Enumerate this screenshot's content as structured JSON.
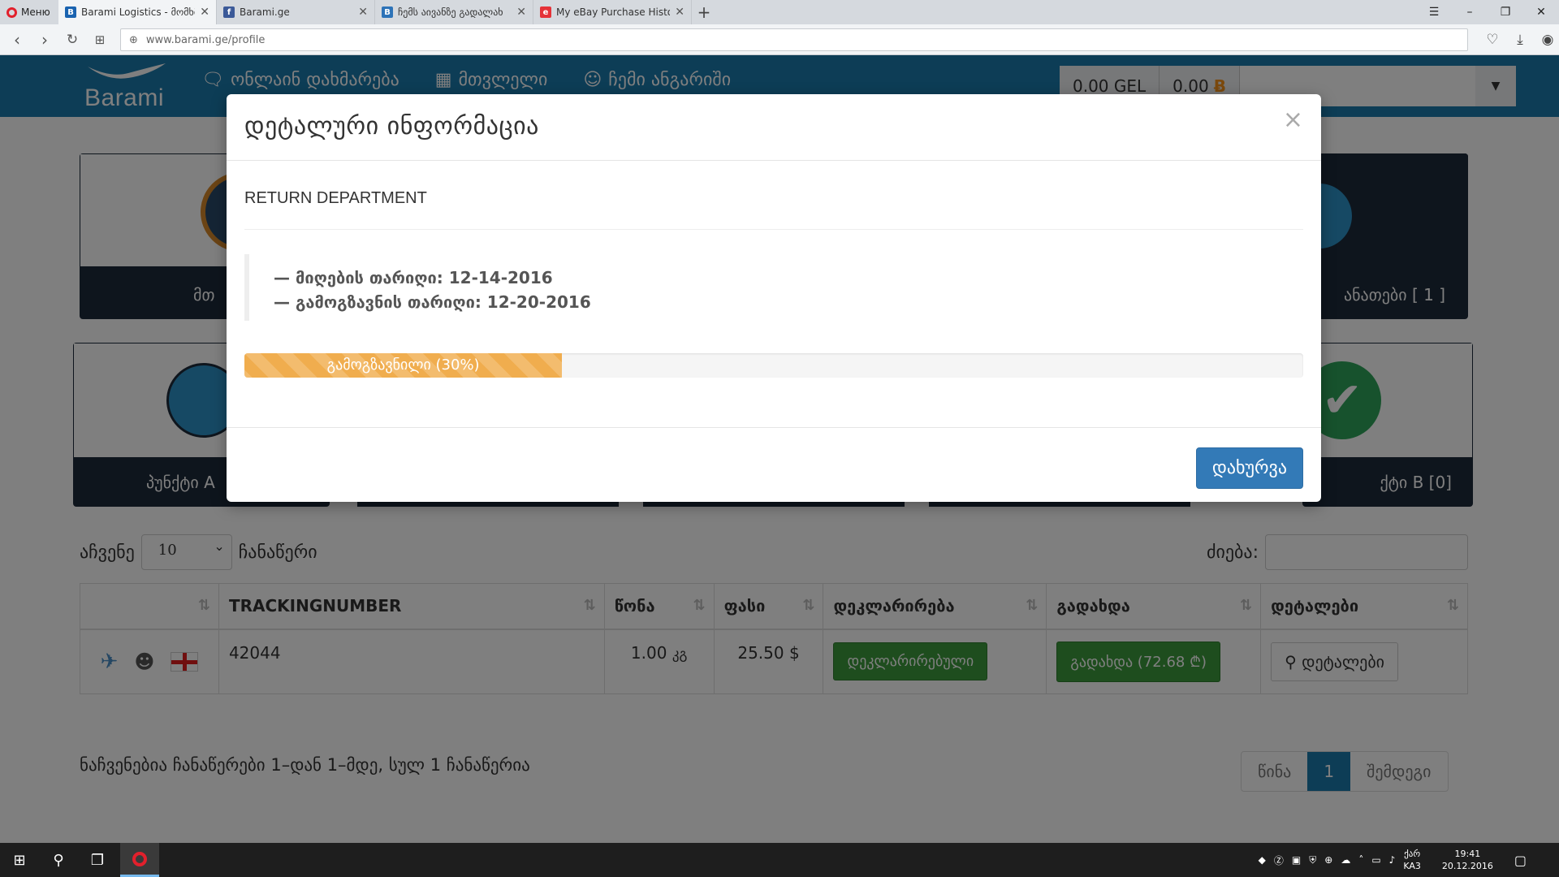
{
  "browser": {
    "menu_label": "Меню",
    "tabs": [
      {
        "title": "Barami Logistics - მომხმ",
        "fav": "B",
        "color": "#1a63b0"
      },
      {
        "title": "Barami.ge",
        "fav": "f",
        "color": "#3b5998"
      },
      {
        "title": "ჩემს აივანზე გადალახ",
        "fav": "B",
        "color": "#2d73b8"
      },
      {
        "title": "My eBay Purchase History",
        "fav": "e",
        "color": "#e53238"
      }
    ],
    "new_tab": "+",
    "url": "www.barami.ge/profile"
  },
  "site": {
    "logo": "Barami",
    "nav": [
      {
        "icon": "chat",
        "label": "ონლაინ დახმარება"
      },
      {
        "icon": "calculator",
        "label": "მთვლელი"
      },
      {
        "icon": "user",
        "label": "ჩემი ანგარიში"
      }
    ],
    "balance_gel": "0.00 GEL",
    "balance_btc": "0.00",
    "btc_symbol": "Ƀ"
  },
  "cards": [
    {
      "label": "მთ"
    },
    {
      "label": "ანათები [ 1 ]"
    },
    {
      "label": "პუნქტი A"
    },
    {
      "label": "ქტი B [0]"
    }
  ],
  "table_controls": {
    "show_label": "აჩვენე",
    "length_value": "10",
    "records_label": "ჩანაწერი",
    "search_label": "ძიება:"
  },
  "table": {
    "headers": [
      "",
      "TRACKINGNUMBER",
      "წონა",
      "ფასი",
      "დეკლარირება",
      "გადახდა",
      "დეტალები"
    ],
    "row": {
      "tracking": "42044",
      "weight": "1.00",
      "weight_unit": "კგ",
      "price": "25.50 $",
      "declare_btn": "დეკლარირებული",
      "pay_btn": "გადახდა (72.68 ₾)",
      "details_btn": "დეტალები"
    }
  },
  "info_text": "ნაჩვენებია ჩანაწერები 1–დან 1–მდე, სულ 1 ჩანაწერია",
  "pager": {
    "prev": "წინა",
    "current": "1",
    "next": "შემდეგი"
  },
  "modal": {
    "title": "დეტალური ინფორმაცია",
    "close_x": "×",
    "department": "RETURN DEPARTMENT",
    "received": "— მიღების თარიღი: 12-14-2016",
    "sent": "— გამოგზავნის თარიღი: 12-20-2016",
    "progress_label": "გამოგზავნილი (30%)",
    "progress": 0.3,
    "close_btn": "დახურვა"
  },
  "taskbar": {
    "lang": "ქარ",
    "lang2": "KA3",
    "time": "19:41",
    "date": "20.12.2016"
  }
}
